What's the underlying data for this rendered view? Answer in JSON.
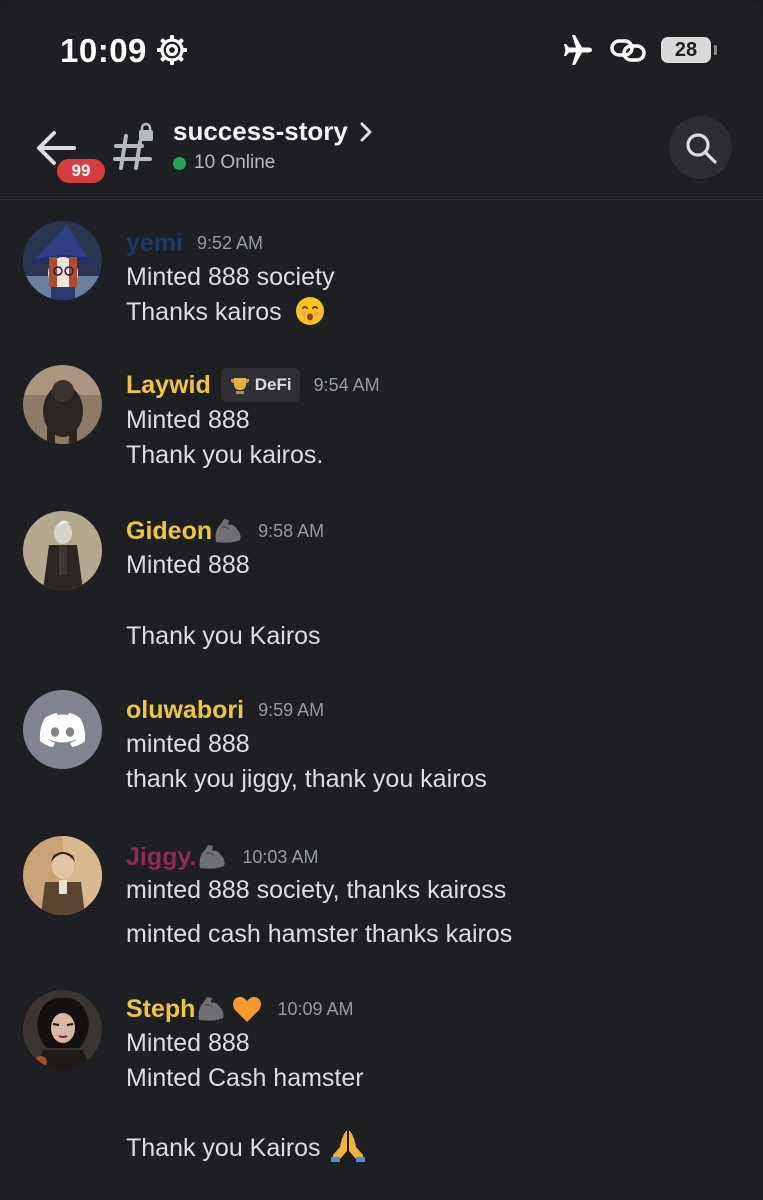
{
  "status_bar": {
    "time": "10:09",
    "battery": "28"
  },
  "header": {
    "mention_count": "99",
    "channel_name": "success-story",
    "online": "10 Online"
  },
  "colors": {
    "background": "#1e1f23",
    "online_green": "#23a55a",
    "badge_red": "#d83c3e",
    "username_gold": "#f0c53a",
    "username_blue": "#1c3a63",
    "username_magenta": "#8e2a55"
  },
  "messages": [
    {
      "username": "yemi",
      "time": "9:52 AM",
      "lines": [
        "Minted 888 society",
        "Thanks kairos"
      ],
      "emoji_after_line_2": "kissing-face-emoji"
    },
    {
      "username": "Laywid",
      "tag": "DeFi",
      "time": "9:54 AM",
      "lines": [
        "Minted 888",
        "Thank you kairos."
      ]
    },
    {
      "username": "Gideon",
      "time": "9:58 AM",
      "lines": [
        "Minted 888",
        "Thank you Kairos"
      ],
      "icons": [
        "flexed-biceps-emoji"
      ]
    },
    {
      "username": "oluwabori",
      "time": "9:59 AM",
      "lines": [
        "minted 888",
        "thank you jiggy, thank you kairos"
      ]
    },
    {
      "username": "Jiggy.",
      "time": "10:03 AM",
      "lines": [
        "minted 888 society, thanks kaiross",
        "minted cash hamster thanks kairos"
      ],
      "icons": [
        "flexed-biceps-emoji"
      ]
    },
    {
      "username": "Steph",
      "time": "10:09 AM",
      "lines": [
        "Minted 888",
        "Minted Cash hamster",
        "Thank you Kairos"
      ],
      "icons": [
        "flexed-biceps-emoji",
        "orange-heart-emoji",
        "folded-hands-emoji"
      ]
    }
  ]
}
